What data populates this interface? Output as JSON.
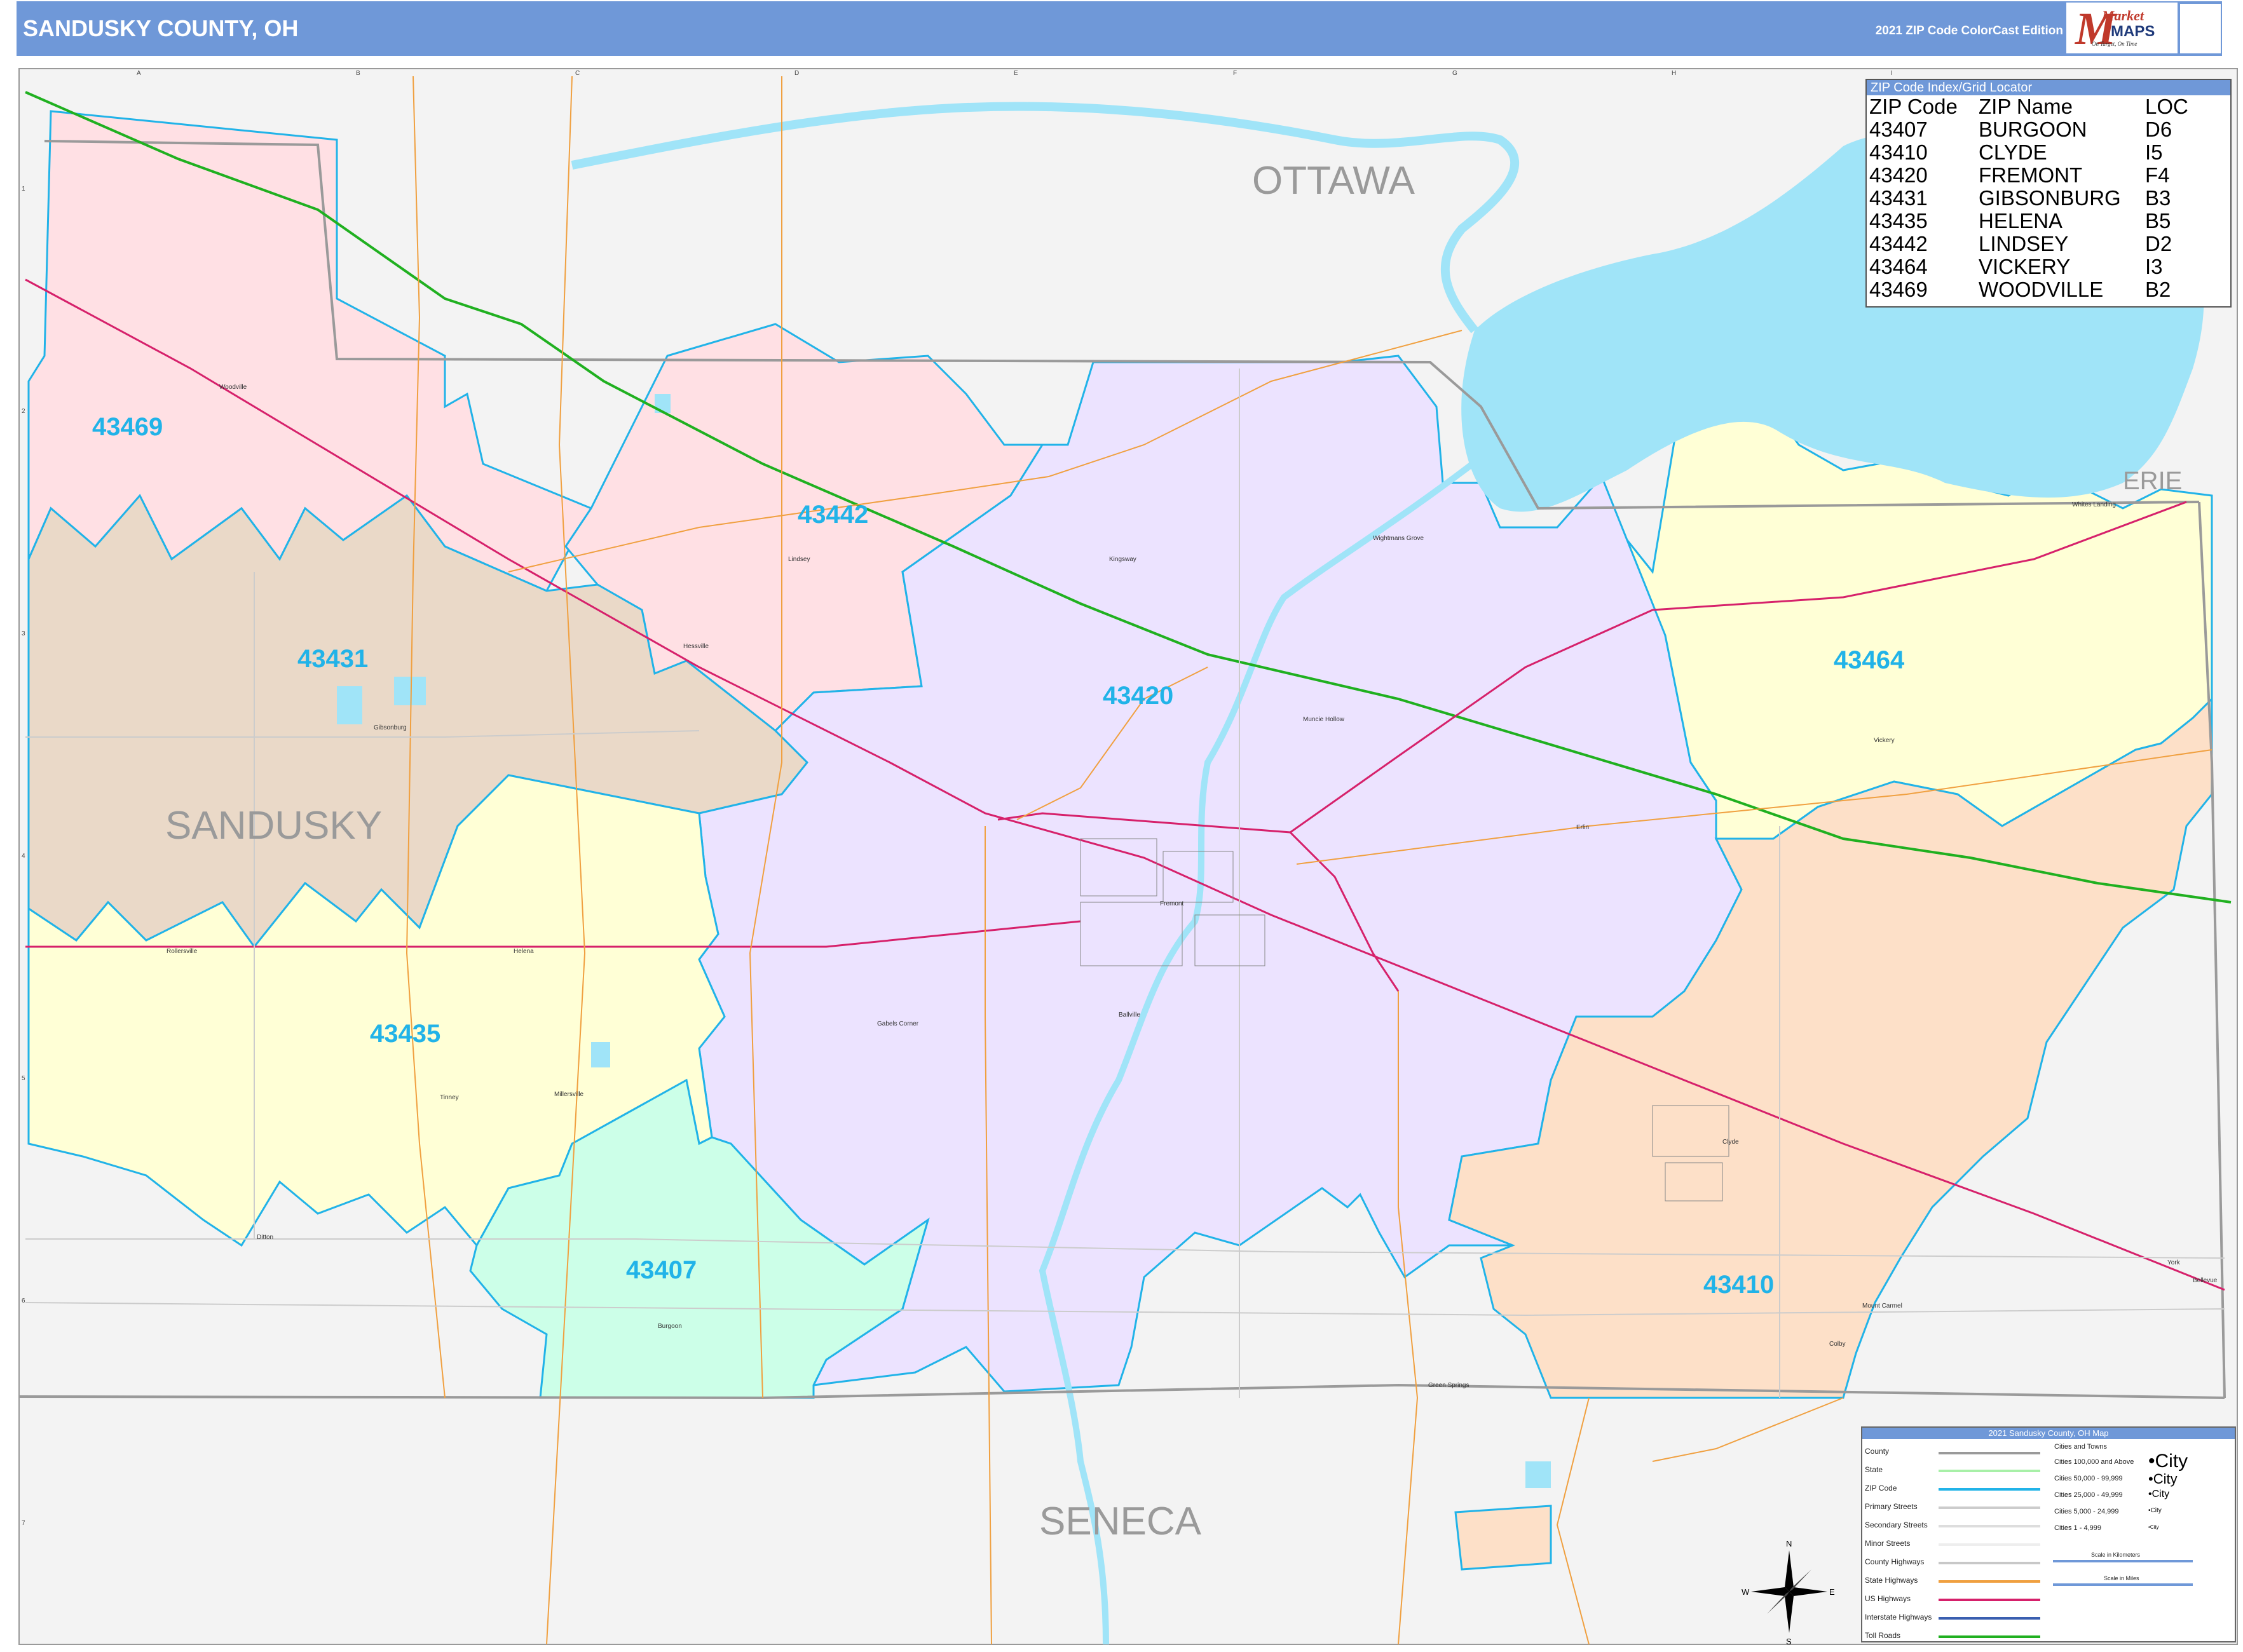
{
  "header": {
    "title": "SANDUSKY COUNTY, OH",
    "edition": "2021 ZIP Code ColorCast Edition",
    "logo": {
      "brand_top": "Market",
      "brand_bottom": "MAPS",
      "tagline": "On Target, On Time"
    },
    "colors": {
      "header_bg": "#6f98d8",
      "header_text": "#ffffff"
    }
  },
  "grid": {
    "columns": [
      "A",
      "B",
      "C",
      "D",
      "E",
      "F",
      "G",
      "H",
      "I"
    ],
    "rows": [
      "1",
      "2",
      "3",
      "4",
      "5",
      "6",
      "7"
    ]
  },
  "counties": {
    "sandusky": "SANDUSKY",
    "ottawa": "OTTAWA",
    "erie": "ERIE",
    "seneca": "SENECA"
  },
  "zips": {
    "z43469": "43469",
    "z43442": "43442",
    "z43431": "43431",
    "z43420": "43420",
    "z43464": "43464",
    "z43435": "43435",
    "z43407": "43407",
    "z43410": "43410"
  },
  "places": {
    "woodville": "Woodville",
    "lindsey": "Lindsey",
    "hessville": "Hessville",
    "gibsonburg": "Gibsonburg",
    "kingsway": "Kingsway",
    "wightmans_grove": "Wightmans Grove",
    "muncie_hollow": "Muncie Hollow",
    "whites_landing": "Whites Landing",
    "vickery": "Vickery",
    "erlin": "Erlin",
    "fremont": "Fremont",
    "ballville": "Ballville",
    "gabels_corner": "Gabels Corner",
    "rollersville": "Rollersville",
    "helena": "Helena",
    "tinney": "Tinney",
    "millersville": "Millersville",
    "clyde": "Clyde",
    "burgoon": "Burgoon",
    "ditton": "Ditton",
    "green_springs": "Green Springs",
    "mount_carmel": "Mount Carmel",
    "colby": "Colby",
    "bellevue": "Bellevue",
    "york": "York"
  },
  "zip_index": {
    "title": "ZIP Code Index/Grid Locator",
    "headers": [
      "ZIP Code",
      "ZIP Name",
      "LOC"
    ],
    "rows": [
      [
        "43407",
        "BURGOON",
        "D6"
      ],
      [
        "43410",
        "CLYDE",
        "I5"
      ],
      [
        "43420",
        "FREMONT",
        "F4"
      ],
      [
        "43431",
        "GIBSONBURG",
        "B3"
      ],
      [
        "43435",
        "HELENA",
        "B5"
      ],
      [
        "43442",
        "LINDSEY",
        "D2"
      ],
      [
        "43464",
        "VICKERY",
        "I3"
      ],
      [
        "43469",
        "WOODVILLE",
        "B2"
      ]
    ]
  },
  "legend": {
    "title": "2021 Sandusky County, OH Map",
    "items": [
      {
        "label": "County",
        "color": "#9a9a9a"
      },
      {
        "label": "State",
        "color": "#a8f0a8"
      },
      {
        "label": "ZIP Code",
        "color": "#21b3e8"
      },
      {
        "label": "Primary Streets",
        "color": "#cccccc"
      },
      {
        "label": "Secondary Streets",
        "color": "#dddddd"
      },
      {
        "label": "Minor Streets",
        "color": "#eeeeee"
      },
      {
        "label": "County Highways",
        "color": "#c8c8c8"
      },
      {
        "label": "State Highways",
        "color": "#f0a040"
      },
      {
        "label": "US Highways",
        "color": "#d6216b"
      },
      {
        "label": "Interstate Highways",
        "color": "#3a5fb0"
      },
      {
        "label": "Toll Roads",
        "color": "#20b020"
      }
    ],
    "cities_heading": "Cities and Towns",
    "cities": [
      {
        "label": "Cities 100,000 and Above",
        "sample": "City"
      },
      {
        "label": "Cities 50,000 - 99,999",
        "sample": "City"
      },
      {
        "label": "Cities 25,000 - 49,999",
        "sample": "City"
      },
      {
        "label": "Cities 5,000 - 24,999",
        "sample": "City"
      },
      {
        "label": "Cities 1 - 4,999",
        "sample": "City"
      }
    ],
    "scale_km": "Scale in Kilometers",
    "scale_mi": "Scale in Miles"
  },
  "compass": {
    "n": "N",
    "s": "S",
    "e": "E",
    "w": "W"
  }
}
